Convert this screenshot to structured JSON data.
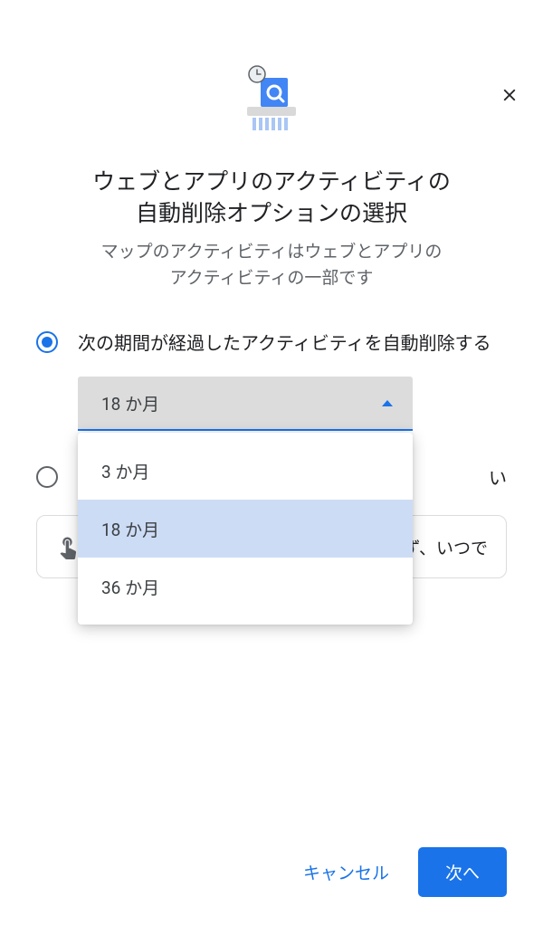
{
  "header": {
    "title_line1": "ウェブとアプリのアクティビティの",
    "title_line2": "自動削除オプションの選択",
    "subtitle_line1": "マップのアクティビティはウェブとアプリの",
    "subtitle_line2": "アクティビティの一部です"
  },
  "options": {
    "auto_delete_label": "次の期間が経過したアクティビティを自動削除する",
    "dont_delete_tail": "い",
    "selected_value": "18 か月",
    "menu": [
      "3 か月",
      "18 か月",
      "36 か月"
    ],
    "selected_index": 1
  },
  "info_box": {
    "tail_text": "らず、いつで"
  },
  "footer": {
    "cancel": "キャンセル",
    "next": "次へ"
  },
  "colors": {
    "primary": "#1a73e8",
    "text": "#202124",
    "muted": "#5f6368"
  }
}
